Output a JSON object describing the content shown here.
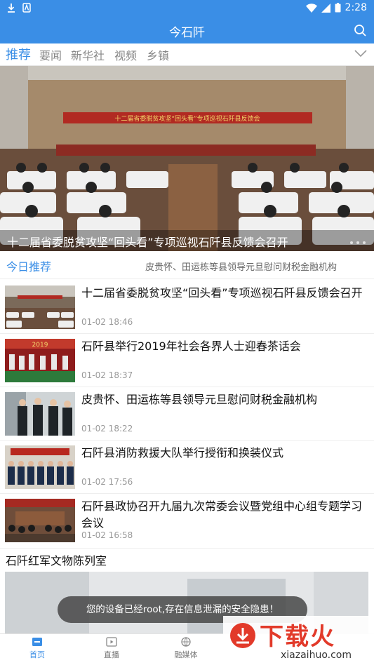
{
  "status_bar": {
    "time": "2:28"
  },
  "app_bar": {
    "title": "今石阡"
  },
  "tabs": [
    {
      "label": "推荐",
      "active": true
    },
    {
      "label": "要闻",
      "active": false
    },
    {
      "label": "新华社",
      "active": false
    },
    {
      "label": "视频",
      "active": false
    },
    {
      "label": "乡镇",
      "active": false
    }
  ],
  "banner": {
    "image_text": "十二届省委脱贫攻坚“回头看”专项巡视石阡县反馈会",
    "caption": "十二届省委脱贫攻坚“回头看”专项巡视石阡县反馈会召开"
  },
  "today": {
    "label": "今日推荐",
    "ticker": "皮贵怀、田运栋等县领导元旦慰问财税金融机构"
  },
  "news": [
    {
      "title": "十二届省委脱贫攻坚“回头看”专项巡视石阡县反馈会召开",
      "time": "01-02 18:46"
    },
    {
      "title": "石阡县举行2019年社会各界人士迎春茶话会",
      "time": "01-02 18:37",
      "image_text": "2019"
    },
    {
      "title": "皮贵怀、田运栋等县领导元旦慰问财税金融机构",
      "time": "01-02 18:22"
    },
    {
      "title": "石阡县消防救援大队举行授衔和换装仪式",
      "time": "01-02 17:56"
    },
    {
      "title": "石阡县政协召开九届九次常委会议暨党组中心组专题学习会议",
      "time": "01-02 16:58"
    }
  ],
  "section": {
    "title": "石阡红军文物陈列室"
  },
  "toast": "您的设备已经root,存在信息泄漏的安全隐患！",
  "bottom_nav": [
    {
      "label": "首页",
      "active": true,
      "icon": "home-icon"
    },
    {
      "label": "直播",
      "active": false,
      "icon": "live-icon"
    },
    {
      "label": "融媒体",
      "active": false,
      "icon": "media-icon"
    }
  ],
  "watermark": {
    "brand": "下载火",
    "site": "xiazaihuo.com"
  },
  "colors": {
    "primary": "#3a8ee6",
    "toast_bg": "#464646",
    "brand_red": "#e23a2a"
  }
}
